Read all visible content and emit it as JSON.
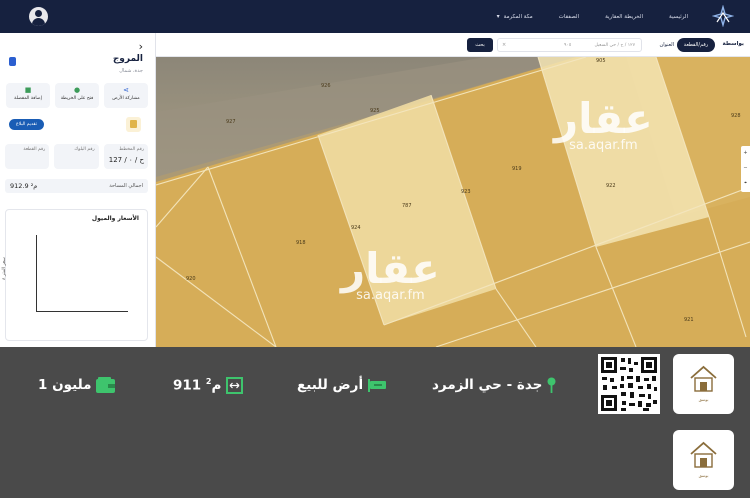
{
  "nav": {
    "items": [
      "الرئيسية",
      "الخريطة العقارية",
      "الصفقات",
      "مكة المكرمة"
    ],
    "chevron": "chevron-down-icon"
  },
  "search": {
    "label": "بواسطة",
    "pill": "رقم/القطعة",
    "tab": "العنوان",
    "placeholder": "١٢٧ / ح / حي السعيل",
    "count": "٩٠٥",
    "go": "بحث"
  },
  "panel": {
    "title": "المروج",
    "subtitle": "جدة، شمال",
    "actions": [
      {
        "label": "مشاركة الأرض",
        "icon": "share-icon"
      },
      {
        "label": "فتح على الخريطة",
        "icon": "map-pin-icon"
      },
      {
        "label": "إضافة المفضلة",
        "icon": "bookmark-icon"
      }
    ],
    "report_button": "تقديم البلاغ",
    "info": [
      {
        "label": "رقم المخطط",
        "value": "127 / ح / ٠"
      },
      {
        "label": "رقم البلوك",
        "value": ""
      },
      {
        "label": "رقم القطعة",
        "value": ""
      }
    ],
    "area_label": "اجمالي المساحة",
    "area_value": "912.9 م²",
    "chart_title": "الأسعار والميول",
    "chart_ylabel": "سعر المتر ٨"
  },
  "map": {
    "parcel_labels": [
      "787",
      "918",
      "919",
      "920",
      "921",
      "922",
      "923",
      "924",
      "925",
      "926",
      "927",
      "928",
      "905"
    ],
    "watermark_big": "عقار",
    "watermark_small": "sa.aqar.fm",
    "controls": [
      "+",
      "−",
      "⌖"
    ]
  },
  "listing": {
    "price": "1 مليون",
    "area_value": "911 م",
    "area_sup": "2",
    "type": "أرض للبيع",
    "location": "جدة - حي الزمرد",
    "thumb_caption": "بوسق",
    "colors": {
      "accent": "#3ec46d",
      "bar": "#4a4a4a",
      "nav": "#16213f"
    }
  }
}
